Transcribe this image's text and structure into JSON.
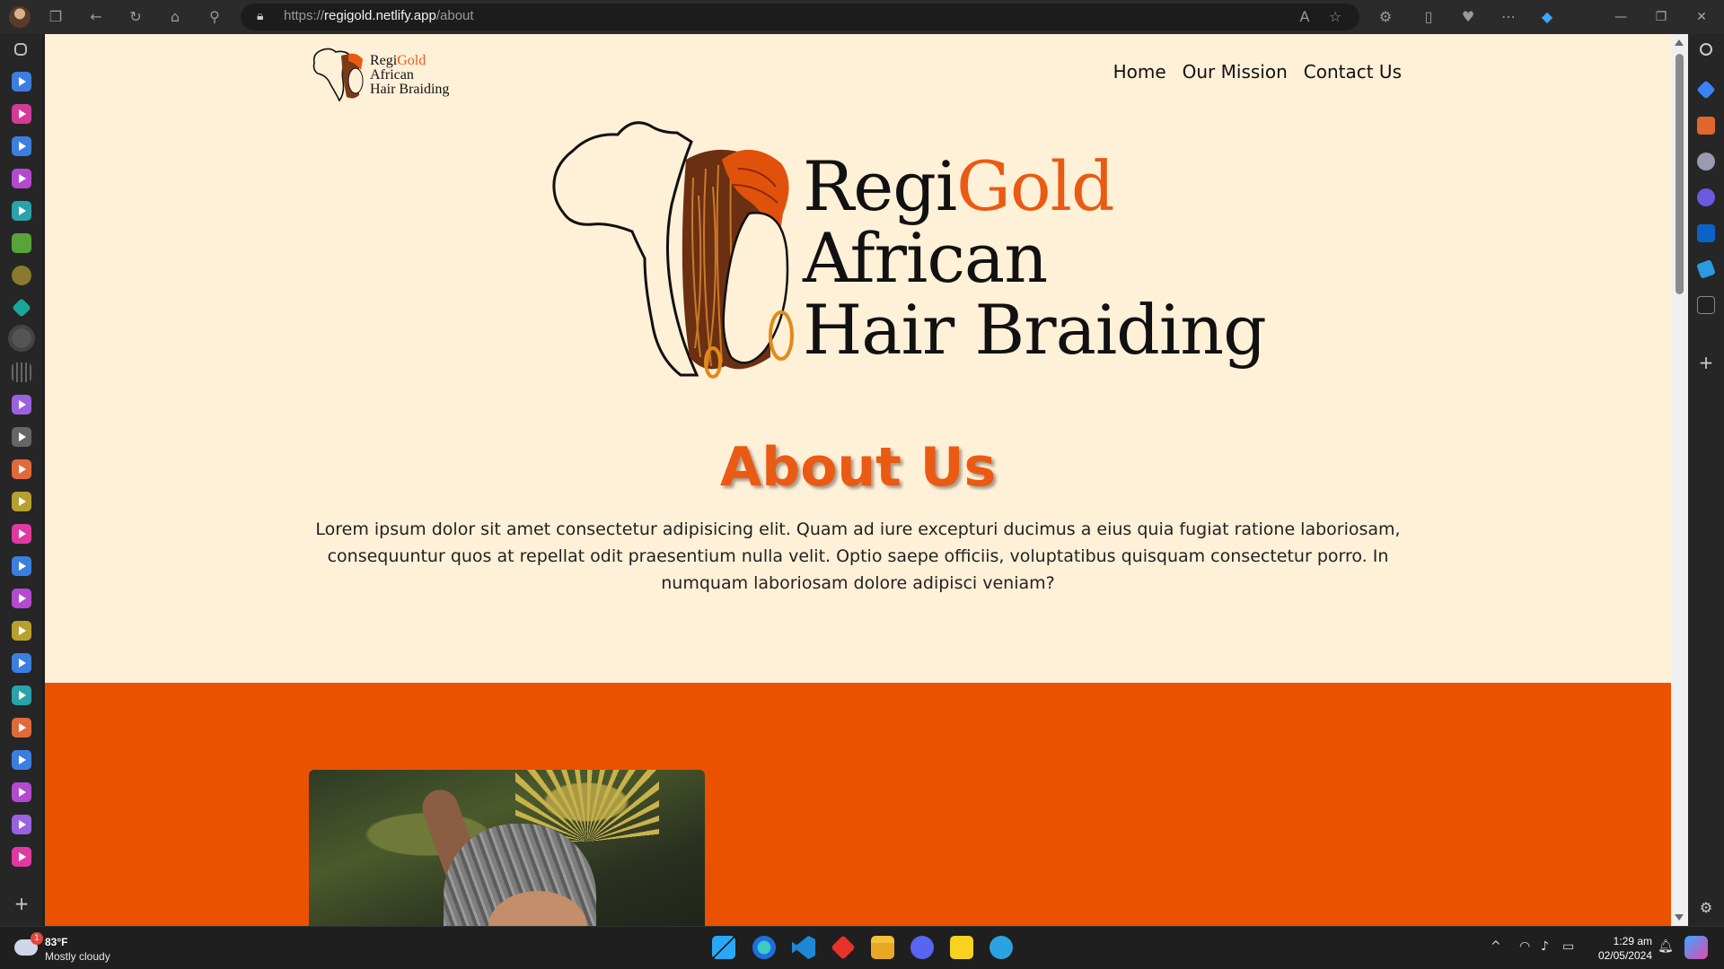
{
  "browser": {
    "url_prefix": "https://",
    "url_host": "regigold.netlify.app",
    "url_path": "/about"
  },
  "site": {
    "logo_small": {
      "line1_a": "Regi",
      "line1_b": "Gold",
      "line2": "African",
      "line3": "Hair Braiding"
    },
    "nav": {
      "home": "Home",
      "mission": "Our Mission",
      "contact": "Contact Us"
    },
    "hero": {
      "word1": "Regi",
      "word2": "Gold",
      "line2": "African",
      "line3": "Hair Braiding"
    },
    "about": {
      "title": "About Us",
      "body": "Lorem ipsum dolor sit amet consectetur adipisicing elit. Quam ad iure excepturi ducimus a eius quia fugiat ratione laboriosam, consequuntur quos at repellat odit praesentium nulla velit. Optio saepe officiis, voluptatibus quisquam consectetur porro. In numquam laboriosam dolore adipisci veniam?"
    }
  },
  "colors": {
    "accent": "#ea5a12",
    "page_bg": "#fff0d8",
    "band": "#ea5200"
  },
  "taskbar": {
    "weather_badge": "1",
    "temperature": "83°F",
    "condition": "Mostly cloudy",
    "time": "1:29 am",
    "date": "02/05/2024"
  }
}
